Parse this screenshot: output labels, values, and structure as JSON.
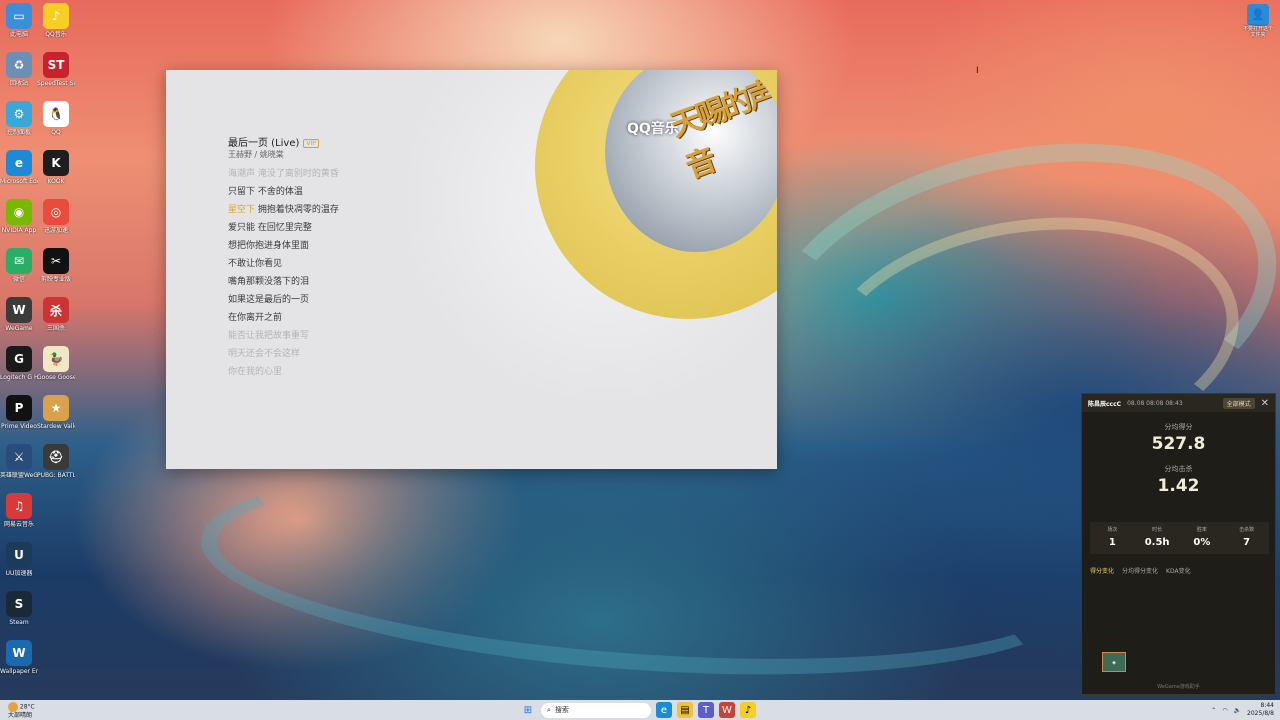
{
  "desktop": {
    "icons_left": [
      {
        "label": "此电脑",
        "icon": "computer-icon",
        "color": "#3a8fd8",
        "glyph": "▭"
      },
      {
        "label": "回收站",
        "icon": "recycle-bin-icon",
        "color": "#6b8fb5",
        "glyph": "♻"
      },
      {
        "label": "控制面板",
        "icon": "control-panel-icon",
        "color": "#3ba7d8",
        "glyph": "⚙"
      },
      {
        "label": "Microsoft Edge",
        "icon": "edge-icon",
        "color": "#1d8ad6",
        "glyph": "e"
      },
      {
        "label": "NVIDIA App",
        "icon": "nvidia-icon",
        "color": "#76b900",
        "glyph": "◉"
      },
      {
        "label": "微信",
        "icon": "wechat-icon",
        "color": "#2aae67",
        "glyph": "✉"
      },
      {
        "label": "WeGame",
        "icon": "wegame-icon",
        "color": "#3b3b3b",
        "glyph": "W"
      },
      {
        "label": "Logitech G HUB",
        "icon": "logitech-icon",
        "color": "#1a1a1a",
        "glyph": "G"
      },
      {
        "label": "Prime Video",
        "icon": "prime-icon",
        "color": "#111111",
        "glyph": "P"
      },
      {
        "label": "英雄联盟WeGame版",
        "icon": "lol-icon",
        "color": "#2b4b7a",
        "glyph": "⚔"
      },
      {
        "label": "网易云音乐",
        "icon": "netease-music-icon",
        "color": "#d83a3a",
        "glyph": "♫"
      },
      {
        "label": "UU加速器",
        "icon": "uu-icon",
        "color": "#1c3a5a",
        "glyph": "U"
      },
      {
        "label": "Steam",
        "icon": "steam-icon",
        "color": "#1b2838",
        "glyph": "S"
      },
      {
        "label": "Wallpaper Engine",
        "icon": "wallpaper-engine-icon",
        "color": "#1a6ab0",
        "glyph": "W"
      }
    ],
    "icons_second": [
      {
        "label": "QQ音乐",
        "icon": "qq-music-icon",
        "color": "#f5d023",
        "glyph": "♪"
      },
      {
        "label": "SpeedTest Supermac",
        "icon": "speedtest-icon",
        "color": "#c8232c",
        "glyph": "ST"
      },
      {
        "label": "QQ",
        "icon": "qq-icon",
        "color": "#ffffff",
        "glyph": "🐧"
      },
      {
        "label": "KOOK",
        "icon": "kook-icon",
        "color": "#1e1e1e",
        "glyph": "K"
      },
      {
        "label": "迅游加速",
        "icon": "xunyou-icon",
        "color": "#e94b3c",
        "glyph": "◎"
      },
      {
        "label": "剪映专业版",
        "icon": "jianying-icon",
        "color": "#111111",
        "glyph": "✂"
      },
      {
        "label": "三国杀",
        "icon": "sanguosha-icon",
        "color": "#c33",
        "glyph": "杀"
      },
      {
        "label": "Goose Goose Duck",
        "icon": "goose-duck-icon",
        "color": "#f0e6c8",
        "glyph": "🦆"
      },
      {
        "label": "Stardew Valley",
        "icon": "stardew-icon",
        "color": "#d9a24a",
        "glyph": "★"
      },
      {
        "label": "PUBG: BATTLEGROUNDS",
        "icon": "pubg-icon",
        "color": "#3a3a3a",
        "glyph": "⛑"
      }
    ],
    "top_right_icon": {
      "label": "不要打开这个文件夹",
      "icon": "folder-person-icon"
    }
  },
  "music_window": {
    "song_title": "最后一页 (Live)",
    "tag": "VIP",
    "artist": "王赫野 / 姚晓棠",
    "lyrics": [
      {
        "text": "海潮声 淹没了离别时的黄昏",
        "dim": true
      },
      {
        "text": "只留下 不舍的体温",
        "dim": false
      },
      {
        "pre": "星空下",
        "text": " 拥抱着快凋零的温存",
        "dim": false,
        "current": true
      },
      {
        "text": "爱只能 在回忆里完整",
        "dim": false
      },
      {
        "text": "想把你抱进身体里面",
        "dim": false
      },
      {
        "text": "不敢让你看见",
        "dim": false
      },
      {
        "text": "嘴角那颗没落下的泪",
        "dim": false
      },
      {
        "text": "如果这是最后的一页",
        "dim": false
      },
      {
        "text": "在你离开之前",
        "dim": false
      },
      {
        "text": "能否让我把故事重写",
        "dim": true
      },
      {
        "text": "明天还会不会这样",
        "dim": true
      },
      {
        "text": "你在我的心里",
        "dim": true
      }
    ],
    "album": {
      "brand": "QQ音乐",
      "show": "天赐的声音"
    }
  },
  "stats_widget": {
    "user": "陈昌辰cccC",
    "date": "08.08 08:08 08:43",
    "mode": "全部模式",
    "avg_score_label": "分均得分",
    "avg_score": "527.8",
    "avg_kills_label": "分均击杀",
    "avg_kills": "1.42",
    "mini": [
      {
        "k": "场次",
        "v": "1"
      },
      {
        "k": "时长",
        "v": "0.5h"
      },
      {
        "k": "胜率",
        "v": "0%"
      },
      {
        "k": "击杀数",
        "v": "7"
      }
    ],
    "tabs": [
      "得分变化",
      "分均得分变化",
      "KDA变化"
    ],
    "footer": "WeGame游戏助手"
  },
  "taskbar": {
    "weather_temp": "大部晴朗",
    "weather_line": "28°C",
    "search_placeholder": "搜索",
    "time": "8:44",
    "date": "2025/8/8"
  }
}
